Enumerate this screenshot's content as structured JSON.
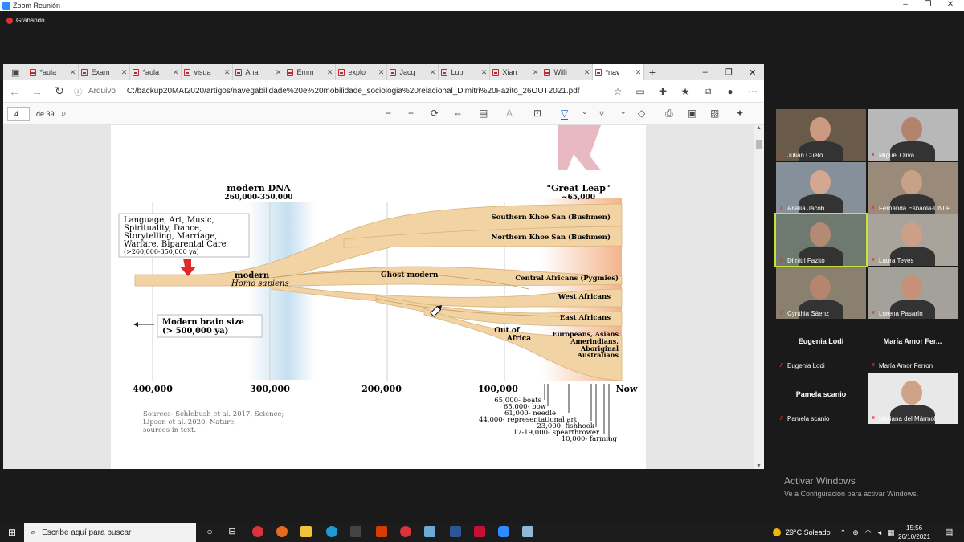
{
  "zoom": {
    "window_title": "Zoom Reunión",
    "recording_label": "Grabando",
    "participants": [
      {
        "name": "Julián Cueto",
        "video": true
      },
      {
        "name": "Miguel Oliva",
        "video": true
      },
      {
        "name": "Analía Jacob",
        "video": true
      },
      {
        "name": "Fernanda Esnaola-UNLP",
        "video": true
      },
      {
        "name": "Dimitri Fazito",
        "video": true,
        "speaking": true
      },
      {
        "name": "Laura Teves",
        "video": true
      },
      {
        "name": "Cynthia Sáenz",
        "video": true
      },
      {
        "name": "Lorena Pasarín",
        "video": true
      },
      {
        "name": "Eugenia Lodi",
        "video": false,
        "display": "Eugenia Lodi"
      },
      {
        "name": "María Amor Ferron",
        "video": false,
        "display": "María Amor Fer..."
      },
      {
        "name": "Pamela scanio",
        "video": false,
        "display": "Pamela scanio"
      },
      {
        "name": "Mariana del Mármol",
        "video": true
      }
    ]
  },
  "browser": {
    "tabs": [
      {
        "label": "*aula"
      },
      {
        "label": "Exam"
      },
      {
        "label": "*aula"
      },
      {
        "label": "visua"
      },
      {
        "label": "Anal"
      },
      {
        "label": "Emm"
      },
      {
        "label": "explo"
      },
      {
        "label": "Jacq"
      },
      {
        "label": "Lubl"
      },
      {
        "label": "Xian"
      },
      {
        "label": "Willi"
      },
      {
        "label": "*nav",
        "active": true
      }
    ],
    "address_label": "Arquivo",
    "url": "C:/backup20MAI2020/artigos/navegabilidade%20e%20mobilidade_sociologia%20relacional_Dimitri%20Fazito_26OUT2021.pdf",
    "page_current": "4",
    "page_total": "de 39"
  },
  "figure": {
    "modern_dna_title": "modern DNA",
    "modern_dna_range": "260,000-350,000",
    "great_leap_title": "\"Great Leap\"",
    "great_leap_value": "~65,000",
    "box_traits": [
      "Language, Art, Music,",
      "Spirituality, Dance,",
      "Storytelling, Marriage,",
      "Warfare, Biparental Care",
      "(>260,000-350,000 ya)"
    ],
    "modern_label": "modern",
    "homo_label": "Homo sapiens",
    "ghost_label": "Ghost modern",
    "brain_box": [
      "Modern brain size",
      "(> 500,000 ya)"
    ],
    "out_of_africa": [
      "Out of",
      "Africa"
    ],
    "populations": [
      "Southern Khoe San (Bushmen)",
      "Northern Khoe San (Bushmen)",
      "Central Africans (Pygmies)",
      "West Africans",
      "East Africans"
    ],
    "eurasians": [
      "Europeans, Asians",
      "Amerindians,",
      "Aboriginal",
      "Australians"
    ],
    "axis_ticks": [
      "400,000",
      "300,000",
      "200,000",
      "100,000",
      "Now"
    ],
    "innovations": [
      "65,000- boats",
      "65,000- bow",
      "61,000- needle",
      "44,000- representational art",
      "23,000- fishhook",
      "17-19,000- spearthrower",
      "10,000- farming"
    ],
    "sources": [
      "Sources- Schlebush et al. 2017, Science;",
      "Lipson et al. 2020, Nature,",
      "sources in text."
    ]
  },
  "windows": {
    "activate_title": "Activar Windows",
    "activate_sub": "Ve a Configuración para activar Windows."
  },
  "taskbar": {
    "search_placeholder": "Escribe aquí para buscar",
    "weather": "29°C  Soleado",
    "time": "15:56",
    "date": "26/10/2021"
  },
  "colors": {
    "branch": "#f2d3a4",
    "blue_band": "#c6dff0",
    "orange_band": "#f3b48a",
    "speaker_outline": "#c9e03c",
    "recording": "#e03030"
  }
}
